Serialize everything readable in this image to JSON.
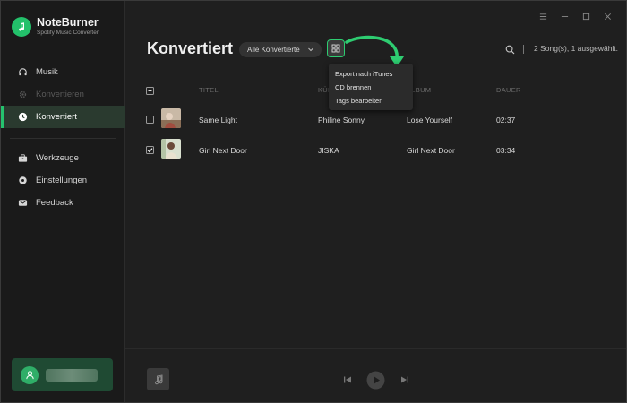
{
  "app": {
    "name": "NoteBurner",
    "subtitle": "Spotify Music Converter"
  },
  "sidebar": {
    "items": [
      {
        "label": "Musik",
        "icon": "headphones-icon"
      },
      {
        "label": "Konvertieren",
        "icon": "gear-icon",
        "disabled": true
      },
      {
        "label": "Konvertiert",
        "icon": "clock-icon",
        "active": true
      },
      {
        "label": "Werkzeuge",
        "icon": "toolbox-icon"
      },
      {
        "label": "Einstellungen",
        "icon": "settings-icon"
      },
      {
        "label": "Feedback",
        "icon": "mail-icon"
      }
    ]
  },
  "header": {
    "title": "Konvertiert",
    "filter": "Alle Konvertierte",
    "count": "2 Song(s), 1 ausgewählt."
  },
  "menu": {
    "items": [
      "Export nach iTunes",
      "CD brennen",
      "Tags bearbeiten"
    ]
  },
  "table": {
    "columns": {
      "title": "TITEL",
      "artist": "KÜNSTLER",
      "album": "ALBUM",
      "duration": "DAUER"
    },
    "rows": [
      {
        "title": "Same Light",
        "artist": "Philine Sonny",
        "album": "Lose Yourself",
        "duration": "02:37",
        "checked": false
      },
      {
        "title": "Girl Next Door",
        "artist": "JISKA",
        "album": "Girl Next Door",
        "duration": "03:34",
        "checked": true
      }
    ]
  },
  "colors": {
    "accent": "#25c26e",
    "background": "#1f1f1f",
    "sidebar": "#1a1a1a"
  }
}
